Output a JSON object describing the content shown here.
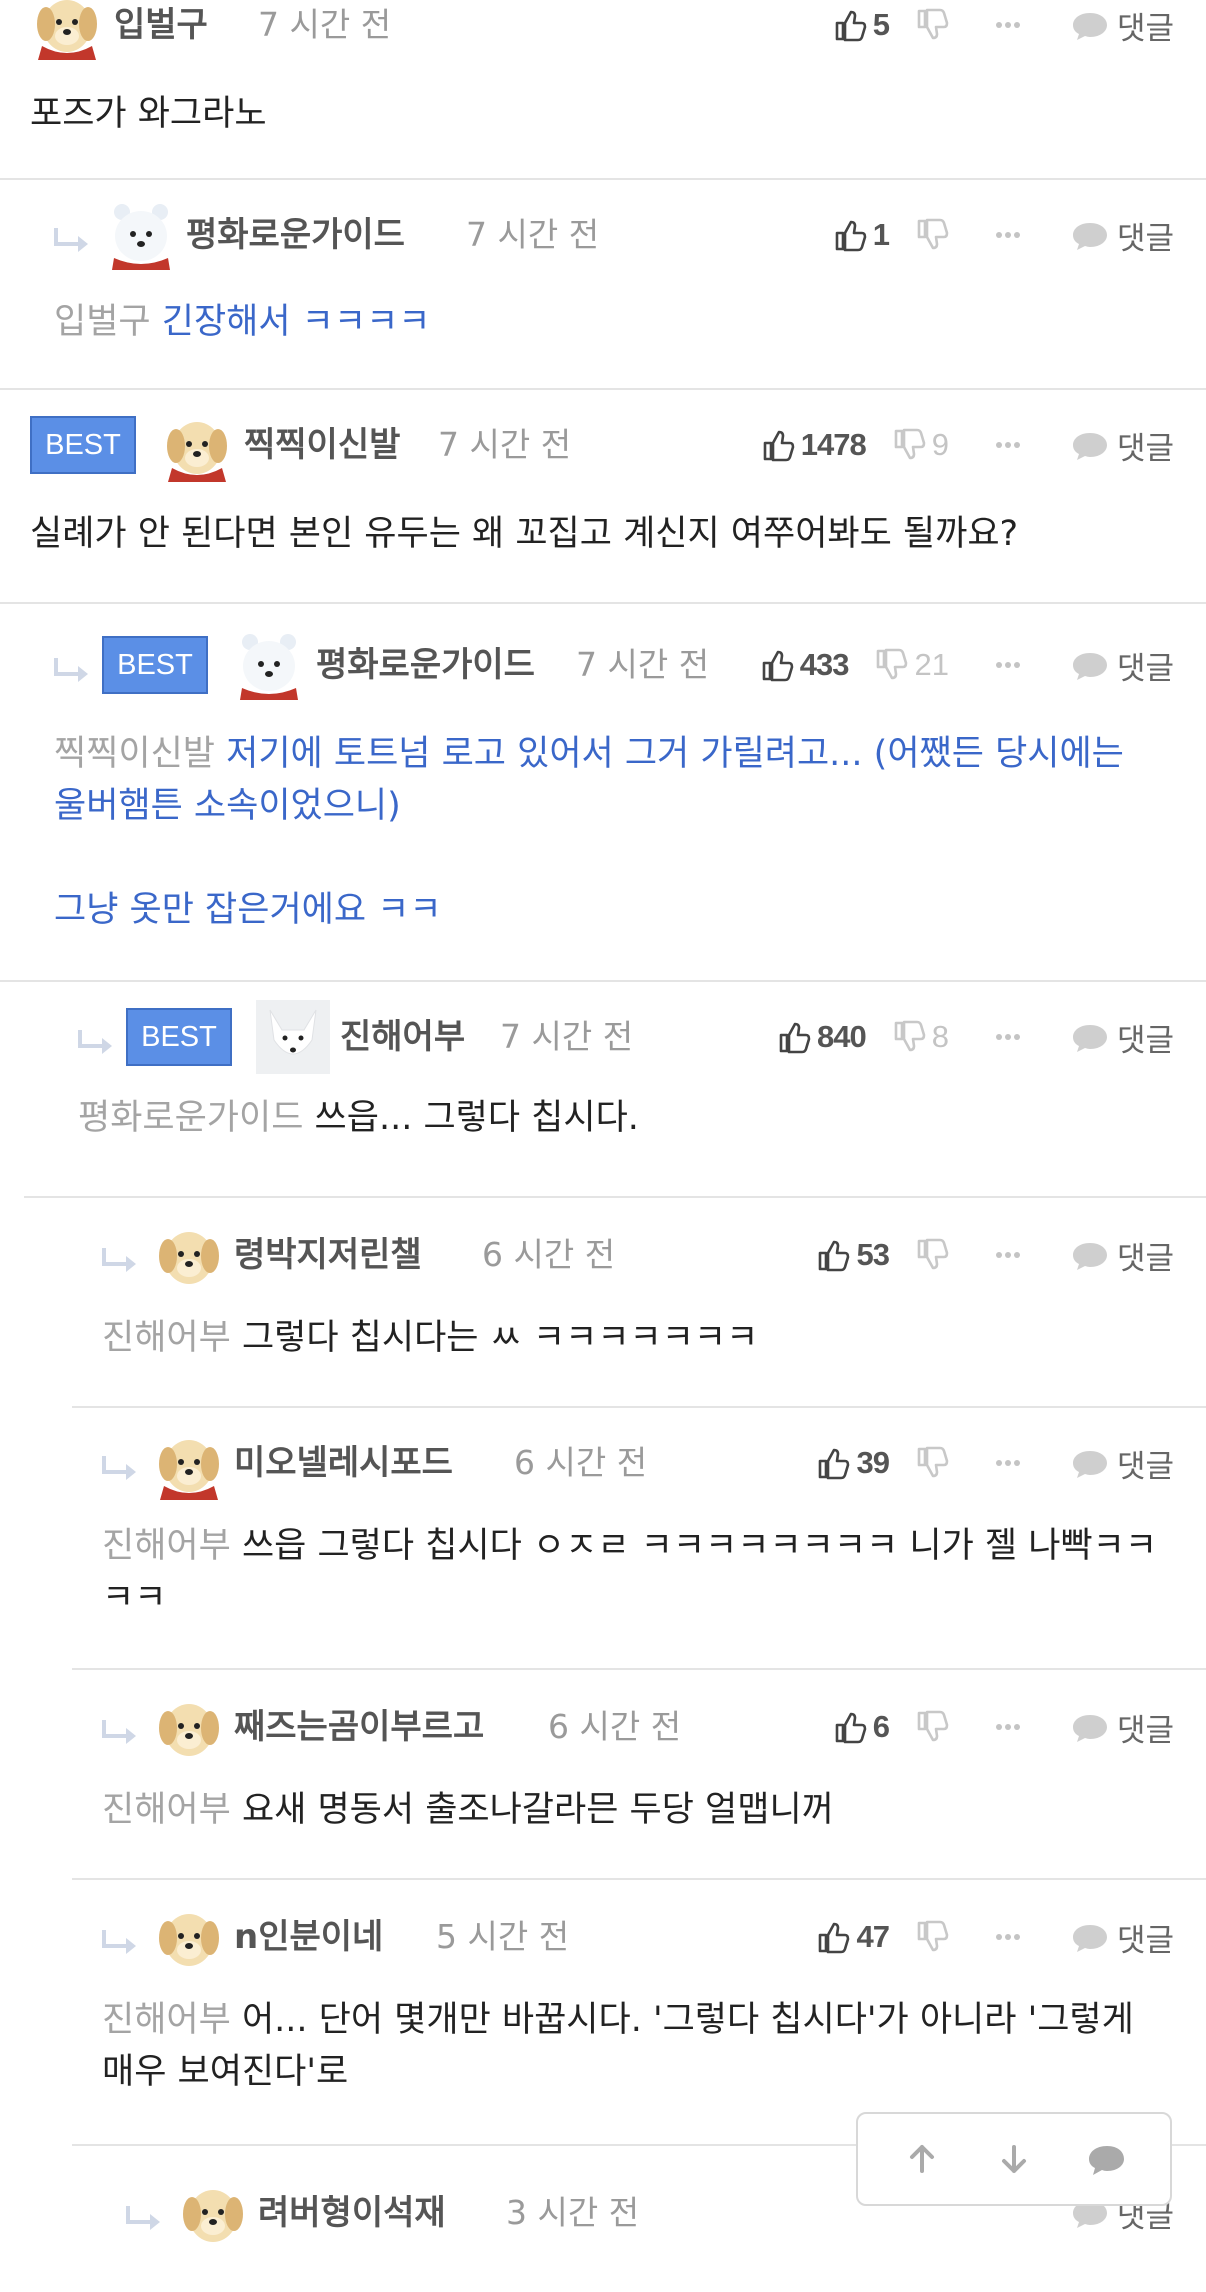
{
  "reply_label": "댓글",
  "best_label": "BEST",
  "comments": [
    {
      "nick": "입벌구",
      "time": "7 시간 전",
      "likes": "5",
      "dislikes": "",
      "mention": "",
      "text": [
        "포즈가 와그라노"
      ]
    },
    {
      "nick": "평화로운가이드",
      "time": "7 시간 전",
      "likes": "1",
      "dislikes": "",
      "mention": "입벌구",
      "text": [
        "긴장해서 ㅋㅋㅋㅋ"
      ]
    },
    {
      "nick": "찍찍이신발",
      "time": "7 시간 전",
      "likes": "1478",
      "dislikes": "9",
      "mention": "",
      "text": [
        "실례가 안 된다면 본인 유두는 왜 꼬집고 계신지 여쭈어봐도 될까요?"
      ]
    },
    {
      "nick": "평화로운가이드",
      "time": "7 시간 전",
      "likes": "433",
      "dislikes": "21",
      "mention": "찍찍이신발",
      "text": [
        "저기에 토트넘 로고 있어서 그거 가릴려고... (어쨌든 당시에는 울버햄튼 소속이었으니)",
        "그냥 옷만 잡은거에요 ㅋㅋ"
      ]
    },
    {
      "nick": "진해어부",
      "time": "7 시간 전",
      "likes": "840",
      "dislikes": "8",
      "mention": "평화로운가이드",
      "text": [
        "쓰읍... 그렇다 칩시다."
      ]
    },
    {
      "nick": "령박지저린챌",
      "time": "6 시간 전",
      "likes": "53",
      "dislikes": "",
      "mention": "진해어부",
      "text": [
        "그렇다 칩시다는 ㅆ ㅋㅋㅋㅋㅋㅋㅋ"
      ]
    },
    {
      "nick": "미오넬레시포드",
      "time": "6 시간 전",
      "likes": "39",
      "dislikes": "",
      "mention": "진해어부",
      "text": [
        "쓰읍 그렇다 칩시다 ㅇㅈㄹ ㅋㅋㅋㅋㅋㅋㅋㅋ 니가 젤 나빡ㅋㅋㅋㅋ"
      ]
    },
    {
      "nick": "째즈는곰이부르고",
      "time": "6 시간 전",
      "likes": "6",
      "dislikes": "",
      "mention": "진해어부",
      "text": [
        "요새 명동서 출조나갈라믄 두당 얼맵니꺼"
      ]
    },
    {
      "nick": "n인분이네",
      "time": "5 시간 전",
      "likes": "47",
      "dislikes": "",
      "mention": "진해어부",
      "text": [
        "어... 단어 몇개만 바꿉시다. '그렇다 칩시다'가 아니라 '그렇게 매우 보여진다'로"
      ]
    },
    {
      "nick": "려버형이석재",
      "time": "3 시간 전",
      "likes": "",
      "dislikes": "",
      "mention": "",
      "text": []
    }
  ]
}
